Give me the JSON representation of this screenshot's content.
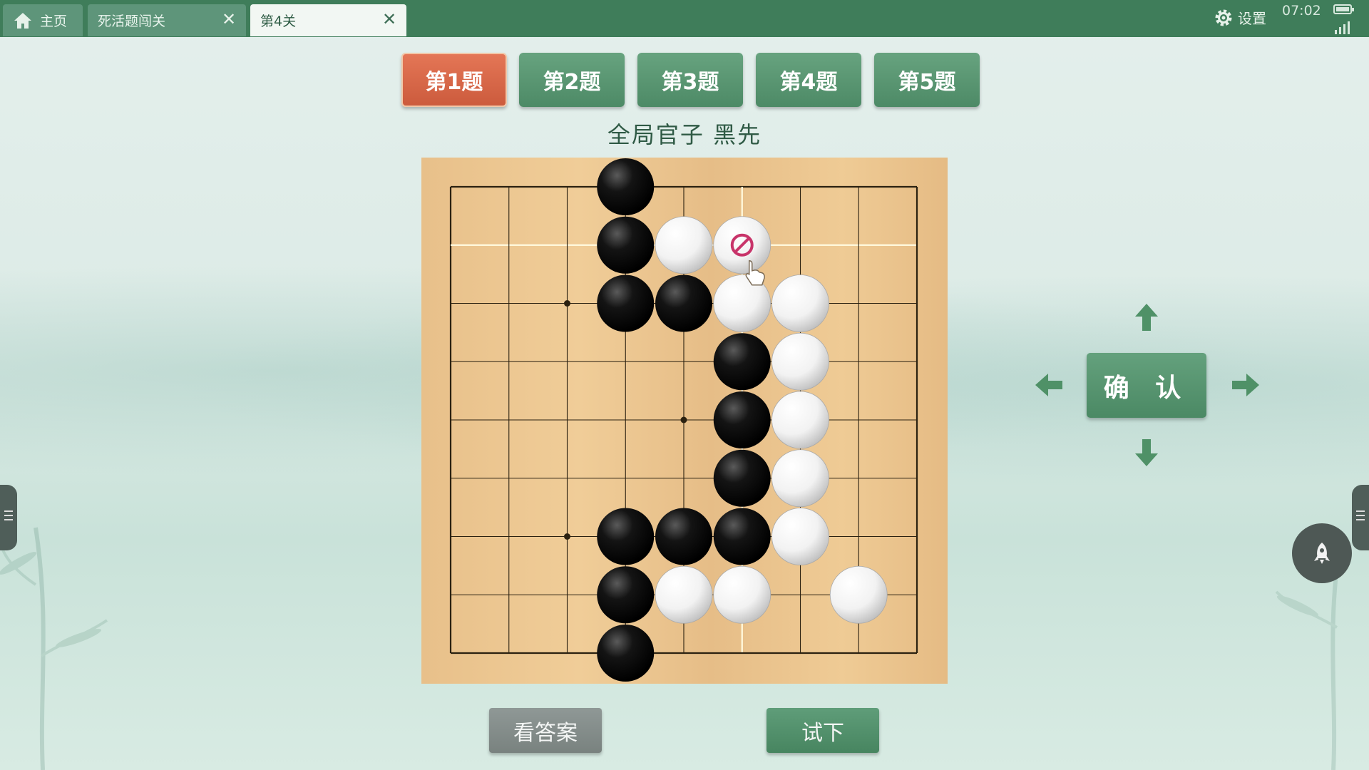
{
  "tabs": [
    {
      "label": "主页",
      "icon": "home-icon"
    },
    {
      "label": "死活题闯关",
      "close": "✕"
    },
    {
      "label": "第4关",
      "close": "✕",
      "active": true
    }
  ],
  "status": {
    "settings_label": "设置",
    "time": "07:02"
  },
  "problems": [
    {
      "label": "第1题",
      "active": true
    },
    {
      "label": "第2题"
    },
    {
      "label": "第3题"
    },
    {
      "label": "第4题"
    },
    {
      "label": "第5题"
    }
  ],
  "subtitle": "全局官子  黑先",
  "board": {
    "size": 9,
    "black": [
      [
        3,
        0
      ],
      [
        3,
        1
      ],
      [
        3,
        2
      ],
      [
        4,
        2
      ],
      [
        5,
        3
      ],
      [
        5,
        4
      ],
      [
        5,
        5
      ],
      [
        3,
        6
      ],
      [
        4,
        6
      ],
      [
        5,
        6
      ],
      [
        3,
        7
      ],
      [
        3,
        8
      ]
    ],
    "white": [
      [
        4,
        1
      ],
      [
        5,
        1
      ],
      [
        5,
        2
      ],
      [
        6,
        2
      ],
      [
        6,
        3
      ],
      [
        6,
        4
      ],
      [
        6,
        5
      ],
      [
        6,
        6
      ],
      [
        4,
        7
      ],
      [
        5,
        7
      ],
      [
        7,
        7
      ]
    ],
    "highlight_lines": {
      "row": 1,
      "col": 5
    },
    "forbidden_marker": [
      5,
      1
    ],
    "star_points": [
      [
        2,
        2
      ],
      [
        4,
        4
      ],
      [
        2,
        6
      ]
    ],
    "colors": {
      "black": "#141414",
      "white": "#f2f2f2",
      "forbidden": "#c8346a",
      "line": "#2b2110",
      "highlight": "#fff6d8"
    }
  },
  "controls": {
    "confirm_label": "确 认"
  },
  "footer": {
    "answer_label": "看答案",
    "try_label": "试下"
  }
}
